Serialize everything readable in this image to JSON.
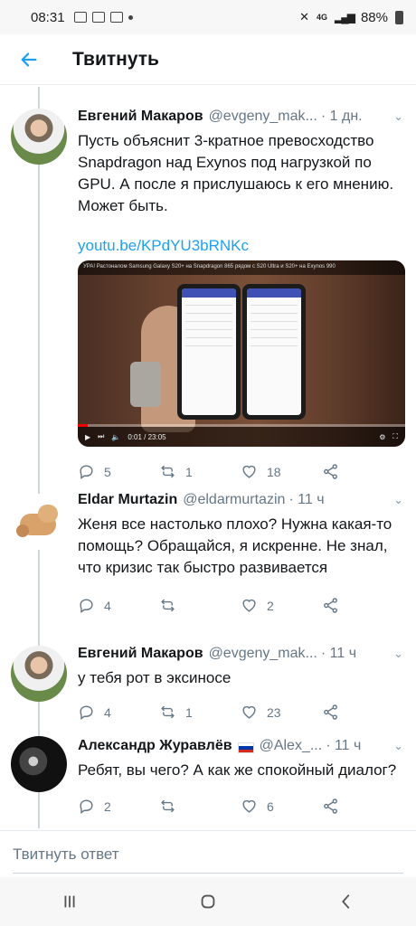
{
  "status_bar": {
    "time": "08:31",
    "network": "4G",
    "battery": "88%"
  },
  "header": {
    "back_icon": "arrow-left-icon",
    "title": "Твитнуть"
  },
  "tweets": [
    {
      "name": "Евгений Макаров",
      "handle": "@evgeny_mak...",
      "time": "· 1 дн.",
      "text": "Пусть объяснит 3-кратное превосходство Snapdragon над Exynos под нагрузкой по GPU. А после я прислушаюсь к его мнению. Может быть.",
      "link": "youtu.be/KPdYU3bRNKc",
      "video_title": "УРА! Растоналом Samsung Galaxy S20+ на Snapdragon 865 рядом с S20 Ultra и S20+ на Exynos 990",
      "video_time": "0:01 / 23:05",
      "video_progress": 0.03,
      "replies": "5",
      "retweets": "1",
      "likes": "18"
    },
    {
      "name": "Eldar Murtazin",
      "handle": "@eldarmurtazin",
      "time": "· 11 ч",
      "text": "Женя все настолько плохо? Нужна какая-то помощь? Обращайся, я искренне. Не знал, что кризис так быстро развивается",
      "replies": "4",
      "retweets": "",
      "likes": "2"
    },
    {
      "name": "Евгений Макаров",
      "handle": "@evgeny_mak...",
      "time": "· 11 ч",
      "text": "у тебя рот в эксиносе",
      "replies": "4",
      "retweets": "1",
      "likes": "23"
    },
    {
      "name": "Александр Журавлёв",
      "handle": "@Alex_...",
      "time": "· 11 ч",
      "text": "Ребят, вы чего? А как же спокойный диалог?",
      "replies": "2",
      "retweets": "",
      "likes": "6"
    }
  ],
  "reply_bar": {
    "placeholder": "Твитнуть ответ"
  },
  "colors": {
    "accent": "#1da1f2",
    "text": "#14171a",
    "secondary": "#657786"
  }
}
